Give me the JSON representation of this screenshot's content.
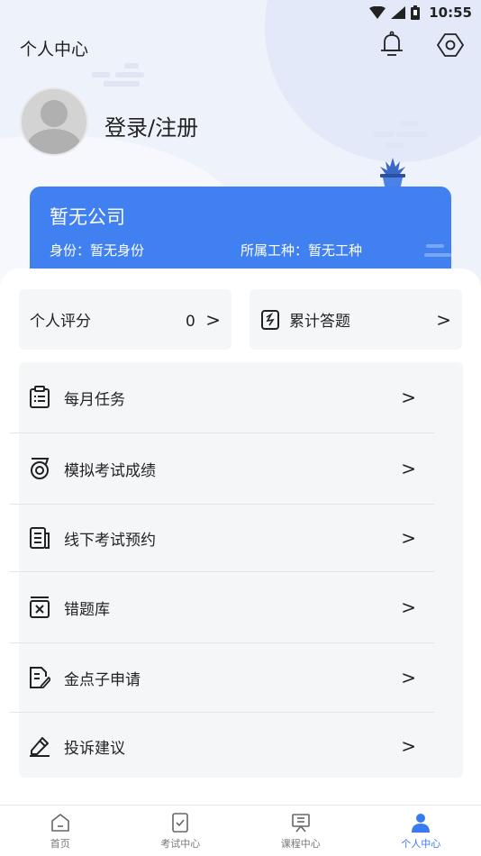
{
  "status_bar": {
    "time": "10:55"
  },
  "header": {
    "title": "个人中心"
  },
  "profile": {
    "login_label": "登录/注册"
  },
  "company_card": {
    "company": "暂无公司",
    "identity": "身份：暂无身份",
    "work_type": "所属工种：暂无工种"
  },
  "stats": {
    "score_label": "个人评分",
    "score_value": "0",
    "answers_label": "累计答题"
  },
  "menu": {
    "items": [
      {
        "label": "每月任务",
        "icon": "clipboard-list-icon"
      },
      {
        "label": "模拟考试成绩",
        "icon": "medal-icon"
      },
      {
        "label": "线下考试预约",
        "icon": "document-list-icon"
      },
      {
        "label": "错题库",
        "icon": "wrong-box-icon"
      },
      {
        "label": "金点子申请",
        "icon": "document-edit-icon"
      },
      {
        "label": "投诉建议",
        "icon": "pen-edit-icon"
      }
    ]
  },
  "tabbar": {
    "tabs": [
      {
        "label": "首页",
        "icon": "home-icon"
      },
      {
        "label": "考试中心",
        "icon": "exam-icon"
      },
      {
        "label": "课程中心",
        "icon": "course-icon"
      },
      {
        "label": "个人中心",
        "icon": "user-icon",
        "active": true
      }
    ]
  },
  "colors": {
    "accent": "#3a7af0",
    "card": "#4080f0"
  }
}
